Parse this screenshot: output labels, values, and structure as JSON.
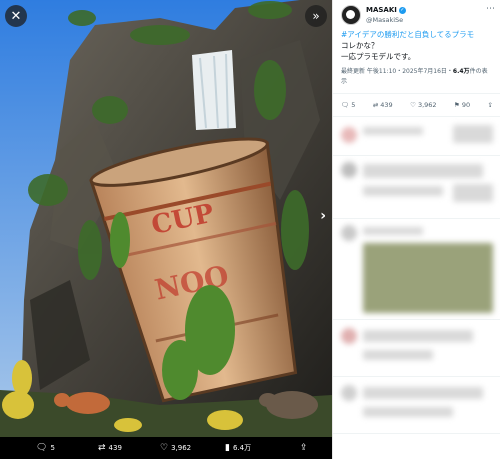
{
  "viewer": {
    "close_icon": "✕",
    "expand_icon": "»",
    "next_icon": "›",
    "actions": {
      "replies": "5",
      "reposts": "439",
      "likes": "3,962",
      "views": "6.4万"
    }
  },
  "post": {
    "display_name": "MASAKI",
    "handle": "@MasakiSe",
    "text_hashtag": "#アイデアの勝利だと自負してるプラモ",
    "text_line2": "コレかな？",
    "text_line3": "一応プラモデルです。",
    "meta_prefix": "最終更新 午後11:10・2025年7月16日・",
    "meta_views": "6.4万",
    "meta_suffix": "件の表示",
    "stats": {
      "replies": "5",
      "reposts": "439",
      "likes": "3,962",
      "bookmarks": "90"
    }
  },
  "colors": {
    "accent": "#1d9bf0",
    "panel_bg": "#ffffff",
    "viewer_bg": "#000000"
  }
}
